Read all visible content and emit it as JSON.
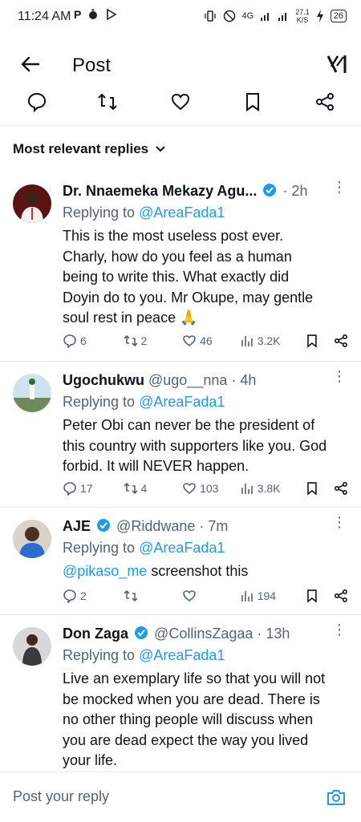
{
  "status_bar": {
    "time": "11:24 AM",
    "network": "4G",
    "speed": "27.1",
    "speed_unit": "K/S",
    "battery": "26"
  },
  "appbar": {
    "title": "Post"
  },
  "sort": {
    "label": "Most relevant replies"
  },
  "replies": [
    {
      "name": "Dr. Nnaemeka Mekazy Agu...",
      "verified": true,
      "handle": "",
      "time": "· 2h",
      "replying_prefix": "Replying to",
      "replying_to": "@AreaFada1",
      "text": "This is the most useless post ever. Charly, how do you feel as a human being to write this. What exactly did Doyin do to you. Mr Okupe, may gentle soul rest in peace 🙏",
      "metrics": {
        "replies": "6",
        "reposts": "2",
        "likes": "46",
        "views": "3.2K"
      }
    },
    {
      "name": "Ugochukwu",
      "verified": false,
      "handle": "@ugo__nna",
      "time": "· 4h",
      "replying_prefix": "Replying to",
      "replying_to": "@AreaFada1",
      "text": "Peter Obi can never be the president of this country with supporters like you. God forbid. It will NEVER happen.",
      "metrics": {
        "replies": "17",
        "reposts": "4",
        "likes": "103",
        "views": "3.8K"
      }
    },
    {
      "name": "AJE",
      "verified": true,
      "handle": "@Riddwane",
      "time": "· 7m",
      "replying_prefix": "Replying to",
      "replying_to": "@AreaFada1",
      "mention": "@pikaso_me",
      "text": "screenshot this",
      "metrics": {
        "replies": "2",
        "reposts": "",
        "likes": "",
        "views": "194"
      }
    },
    {
      "name": "Don Zaga",
      "verified": true,
      "handle": "@CollinsZagaa",
      "time": "· 13h",
      "replying_prefix": "Replying to",
      "replying_to": "@AreaFada1",
      "text": "Live an exemplary life so that you will not be mocked when you are dead. There is no other thing people will discuss when you are dead expect the way you lived your life."
    }
  ],
  "composer": {
    "placeholder": "Post your reply"
  },
  "colors": {
    "accent": "#1d9bf0",
    "text": "#0f1419",
    "muted": "#536471",
    "divider": "#e7e9ea"
  }
}
